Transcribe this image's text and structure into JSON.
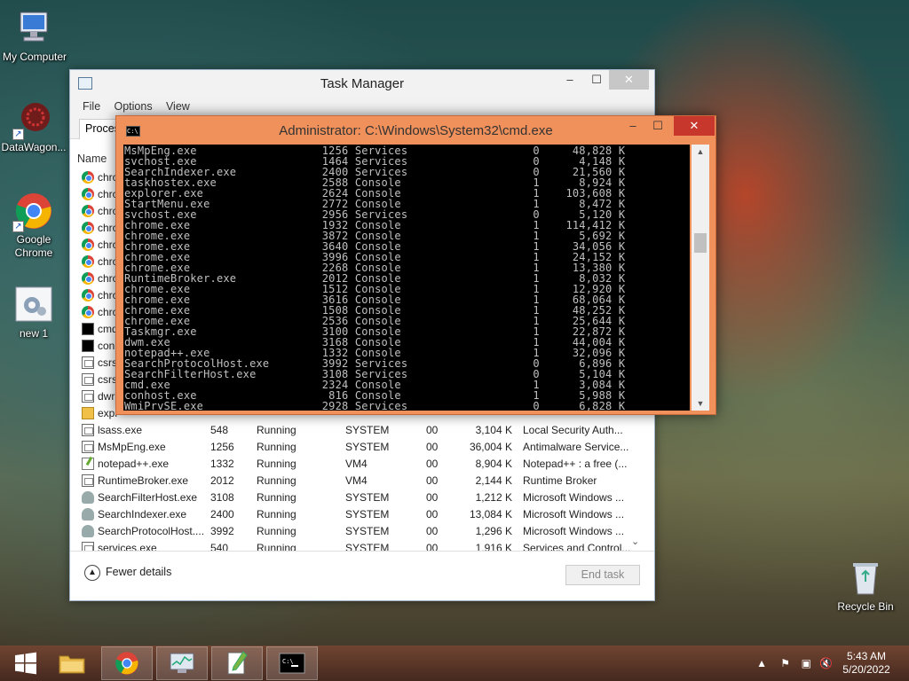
{
  "desktop": {
    "icons": [
      {
        "label": "My Computer",
        "icon": "computer-icon"
      },
      {
        "label": "DataWagon...",
        "icon": "datawagon-icon"
      },
      {
        "label": "Google Chrome",
        "icon": "chrome-icon"
      },
      {
        "label": "new 1",
        "icon": "settings-file-icon"
      },
      {
        "label": "Recycle Bin",
        "icon": "recycle-bin-icon"
      }
    ]
  },
  "taskmgr": {
    "title": "Task Manager",
    "menu": [
      "File",
      "Options",
      "View"
    ],
    "tab_visible": "Proces",
    "name_header": "Name",
    "rows": [
      {
        "icon": "chrome",
        "name": "chro"
      },
      {
        "icon": "chrome",
        "name": "chro"
      },
      {
        "icon": "chrome",
        "name": "chro"
      },
      {
        "icon": "chrome",
        "name": "chro"
      },
      {
        "icon": "chrome",
        "name": "chro"
      },
      {
        "icon": "chrome",
        "name": "chro"
      },
      {
        "icon": "chrome",
        "name": "chro"
      },
      {
        "icon": "chrome",
        "name": "chro"
      },
      {
        "icon": "chrome",
        "name": "chro"
      },
      {
        "icon": "cmd",
        "name": "cmd"
      },
      {
        "icon": "cmd",
        "name": "con"
      },
      {
        "icon": "generic",
        "name": "csrs"
      },
      {
        "icon": "generic",
        "name": "csrs"
      },
      {
        "icon": "generic",
        "name": "dwr"
      },
      {
        "icon": "folder",
        "name": "expl"
      },
      {
        "icon": "generic",
        "name": "lsass.exe",
        "pid": "548",
        "status": "Running",
        "user": "SYSTEM",
        "cpu": "00",
        "mem": "3,104 K",
        "desc": "Local Security Auth..."
      },
      {
        "icon": "generic",
        "name": "MsMpEng.exe",
        "pid": "1256",
        "status": "Running",
        "user": "SYSTEM",
        "cpu": "00",
        "mem": "36,004 K",
        "desc": "Antimalware Service..."
      },
      {
        "icon": "notepad",
        "name": "notepad++.exe",
        "pid": "1332",
        "status": "Running",
        "user": "VM4",
        "cpu": "00",
        "mem": "8,904 K",
        "desc": "Notepad++ : a free (..."
      },
      {
        "icon": "generic",
        "name": "RuntimeBroker.exe",
        "pid": "2012",
        "status": "Running",
        "user": "VM4",
        "cpu": "00",
        "mem": "2,144 K",
        "desc": "Runtime Broker"
      },
      {
        "icon": "user",
        "name": "SearchFilterHost.exe",
        "pid": "3108",
        "status": "Running",
        "user": "SYSTEM",
        "cpu": "00",
        "mem": "1,212 K",
        "desc": "Microsoft Windows ..."
      },
      {
        "icon": "user",
        "name": "SearchIndexer.exe",
        "pid": "2400",
        "status": "Running",
        "user": "SYSTEM",
        "cpu": "00",
        "mem": "13,084 K",
        "desc": "Microsoft Windows ..."
      },
      {
        "icon": "user",
        "name": "SearchProtocolHost....",
        "pid": "3992",
        "status": "Running",
        "user": "SYSTEM",
        "cpu": "00",
        "mem": "1,296 K",
        "desc": "Microsoft Windows ..."
      },
      {
        "icon": "generic",
        "name": "services.exe",
        "pid": "540",
        "status": "Running",
        "user": "SYSTEM",
        "cpu": "00",
        "mem": "1,916 K",
        "desc": "Services and Control..."
      }
    ],
    "fewer_details": "Fewer details",
    "end_task": "End task"
  },
  "cmd": {
    "title": "Administrator: C:\\Windows\\System32\\cmd.exe",
    "lines": [
      "MsMpEng.exe                   1256 Services                   0     48,828 K",
      "svchost.exe                   1464 Services                   0      4,148 K",
      "SearchIndexer.exe             2400 Services                   0     21,560 K",
      "taskhostex.exe                2588 Console                    1      8,924 K",
      "explorer.exe                  2624 Console                    1    103,608 K",
      "StartMenu.exe                 2772 Console                    1      8,472 K",
      "svchost.exe                   2956 Services                   0      5,120 K",
      "chrome.exe                    1932 Console                    1    114,412 K",
      "chrome.exe                    3872 Console                    1      5,692 K",
      "chrome.exe                    3640 Console                    1     34,056 K",
      "chrome.exe                    3996 Console                    1     24,152 K",
      "chrome.exe                    2268 Console                    1     13,380 K",
      "RuntimeBroker.exe             2012 Console                    1      8,032 K",
      "chrome.exe                    1512 Console                    1     12,920 K",
      "chrome.exe                    3616 Console                    1     68,064 K",
      "chrome.exe                    1508 Console                    1     48,252 K",
      "chrome.exe                    2536 Console                    1     25,644 K",
      "Taskmgr.exe                   3100 Console                    1     22,872 K",
      "dwm.exe                       3168 Console                    1     44,004 K",
      "notepad++.exe                 1332 Console                    1     32,096 K",
      "SearchProtocolHost.exe        3992 Services                   0      6,896 K",
      "SearchFilterHost.exe          3108 Services                   0      5,104 K",
      "cmd.exe                       2324 Console                    1      3,084 K",
      "conhost.exe                    816 Console                    1      5,988 K",
      "WmiPrvSE.exe                  2928 Services                   0      6,828 K"
    ]
  },
  "taskbar": {
    "items": [
      {
        "name": "start-button",
        "icon": "windows-logo-icon"
      },
      {
        "name": "taskbar-explorer",
        "icon": "folder-icon"
      },
      {
        "name": "taskbar-chrome",
        "icon": "chrome-icon"
      },
      {
        "name": "taskbar-taskmgr",
        "icon": "task-manager-icon"
      },
      {
        "name": "taskbar-notepadpp",
        "icon": "notepadpp-icon"
      },
      {
        "name": "taskbar-cmd",
        "icon": "cmd-icon"
      }
    ],
    "time": "5:43 AM",
    "date": "5/20/2022"
  }
}
